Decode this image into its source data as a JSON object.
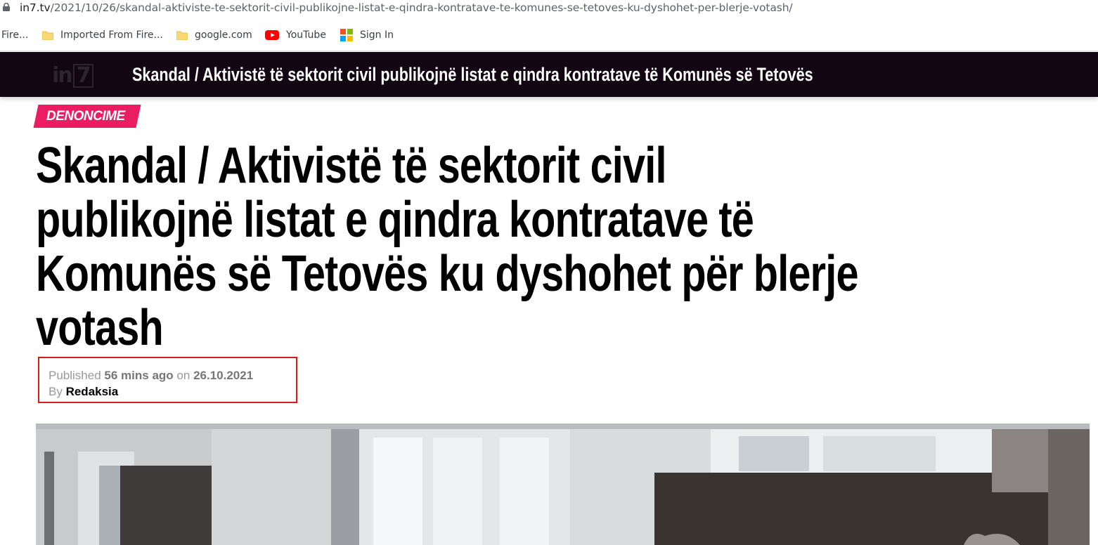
{
  "browser": {
    "url_host": "in7.tv",
    "url_path": "/2021/10/26/skandal-aktiviste-te-sektorit-civil-publikojne-listat-e-qindra-kontratave-te-komunes-se-tetoves-ku-dyshohet-per-blerje-votash/",
    "bookmarks": [
      {
        "label": "Fire...",
        "icon": "none"
      },
      {
        "label": "Imported From Fire...",
        "icon": "folder-icon"
      },
      {
        "label": "google.com",
        "icon": "folder-icon"
      },
      {
        "label": "YouTube",
        "icon": "youtube-icon"
      },
      {
        "label": "Sign In",
        "icon": "microsoft-icon"
      }
    ]
  },
  "site": {
    "logo_text_in": "in",
    "logo_text_7": "7",
    "sticky_title": "Skandal / Aktivistë të sektorit civil publikojnë listat e qindra kontratave të Komunës së Tetovës ku dyshohet për blerje votash"
  },
  "article": {
    "category": "DENONCIME",
    "title": "Skandal / Aktivistë të sektorit civil publikojnë listat e qindra kontratave të Komunës së Tetovës ku dyshohet për blerje votash",
    "published_label": "Published",
    "published_relative": "56 mins ago",
    "published_on_label": "on",
    "published_date": "26.10.2021",
    "by_label": "By",
    "author": "Redaksia"
  },
  "colors": {
    "topbar_bg": "#120612",
    "category_bg": "#ea1d63",
    "highlight_box": "#e01818"
  }
}
